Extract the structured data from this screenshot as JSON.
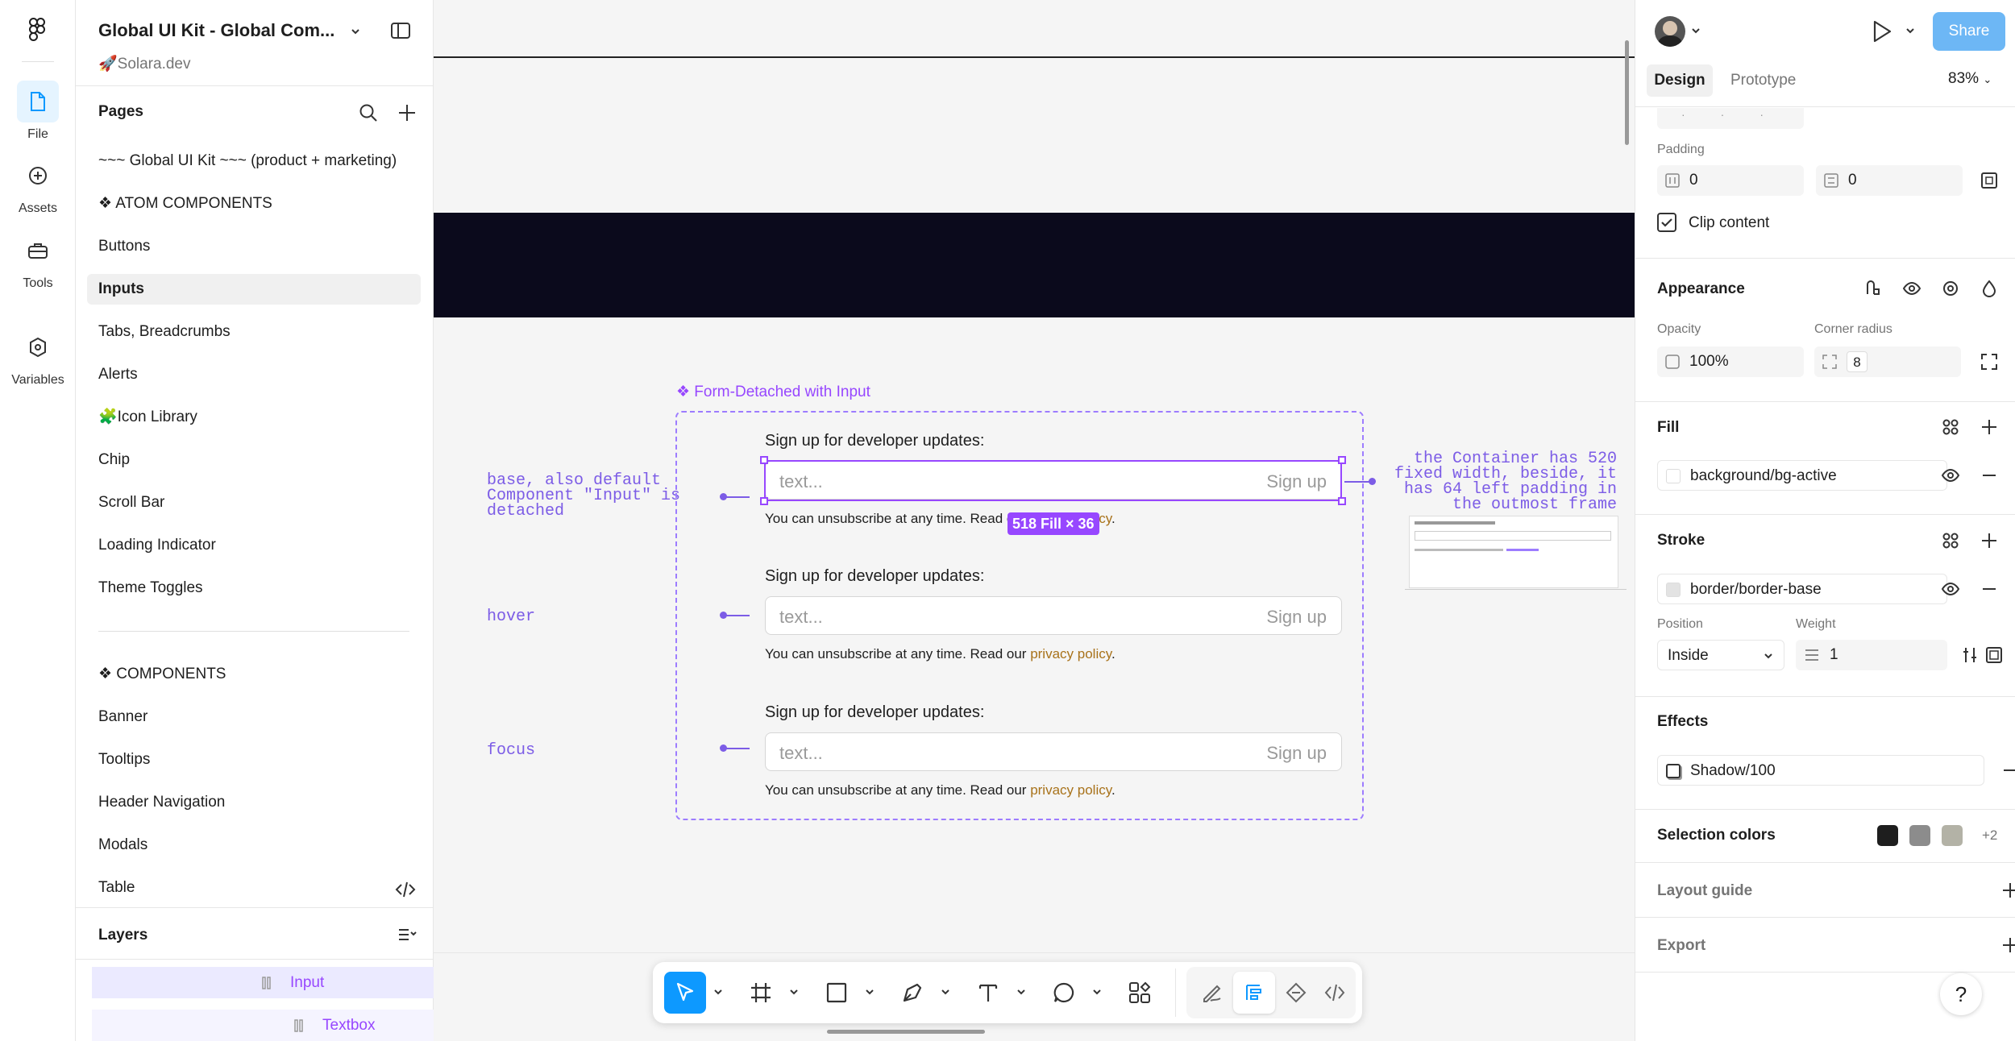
{
  "rail": {
    "items": [
      {
        "label": "File",
        "icon": "file-icon"
      },
      {
        "label": "Assets",
        "icon": "assets-icon"
      },
      {
        "label": "Tools",
        "icon": "toolbox-icon"
      },
      {
        "label": "Variables",
        "icon": "variables-icon"
      }
    ]
  },
  "file": {
    "title": "Global UI Kit - Global Com...",
    "project": "🚀Solara.dev"
  },
  "pages": {
    "header": "Pages",
    "items": [
      "~~~ Global UI Kit ~~~ (product + marketing)",
      "❖ ATOM COMPONENTS",
      "Buttons",
      "Inputs",
      "Tabs, Breadcrumbs",
      "Alerts",
      "🧩Icon Library",
      "Chip",
      "Scroll Bar",
      "Loading Indicator",
      "Theme Toggles",
      "❖ COMPONENTS",
      "Banner",
      "Tooltips",
      "Header Navigation",
      "Modals",
      "Table"
    ],
    "selected": "Inputs"
  },
  "layers": {
    "header": "Layers",
    "items": [
      "Input",
      "Textbox"
    ]
  },
  "canvas": {
    "component_title": "❖ Form-Detached with Input",
    "annotations": {
      "base": "base, also default\nComponent \"Input\" is\ndetached",
      "hover": "hover",
      "focus": "focus",
      "right_note": "the Container has 520\nfixed width, beside, it\nhas 64 left padding in\nthe outmost frame"
    },
    "forms": [
      {
        "heading": "Sign up for developer updates:",
        "placeholder": "text...",
        "button": "Sign up",
        "note": "You can unsubscribe at any time. Read our ",
        "link": "privacy policy",
        "end": "."
      },
      {
        "heading": "Sign up for developer updates:",
        "placeholder": "text...",
        "button": "Sign up",
        "note": "You can unsubscribe at any time. Read our ",
        "link": "privacy policy",
        "end": "."
      },
      {
        "heading": "Sign up for developer updates:",
        "placeholder": "text...",
        "button": "Sign up",
        "note": "You can unsubscribe at any time. Read our ",
        "link": "privacy policy",
        "end": "."
      }
    ],
    "size_badge": "518 Fill × 36"
  },
  "right": {
    "share": "Share",
    "tabs": [
      "Design",
      "Prototype"
    ],
    "zoom": "83%",
    "padding_label": "Padding",
    "padding_h": "0",
    "padding_v": "0",
    "clip_content": "Clip content",
    "appearance": "Appearance",
    "opacity_label": "Opacity",
    "opacity": "100%",
    "radius_label": "Corner radius",
    "radius": "8",
    "fill": "Fill",
    "fill_value": "background/bg-active",
    "stroke": "Stroke",
    "stroke_value": "border/border-base",
    "position_label": "Position",
    "position": "Inside",
    "weight_label": "Weight",
    "weight": "1",
    "effects": "Effects",
    "effect_value": "Shadow/100",
    "selection_colors": "Selection colors",
    "selection_more": "+2",
    "selection_swatches": [
      "#1e1e1e",
      "#8c8c8c",
      "#b3b2a6"
    ],
    "layout_guide": "Layout guide",
    "export": "Export",
    "help": "?"
  },
  "colors": {
    "accent": "#0d99ff",
    "component": "#9747ff",
    "link": "#a8721a",
    "banner": "#0b0a1c"
  }
}
